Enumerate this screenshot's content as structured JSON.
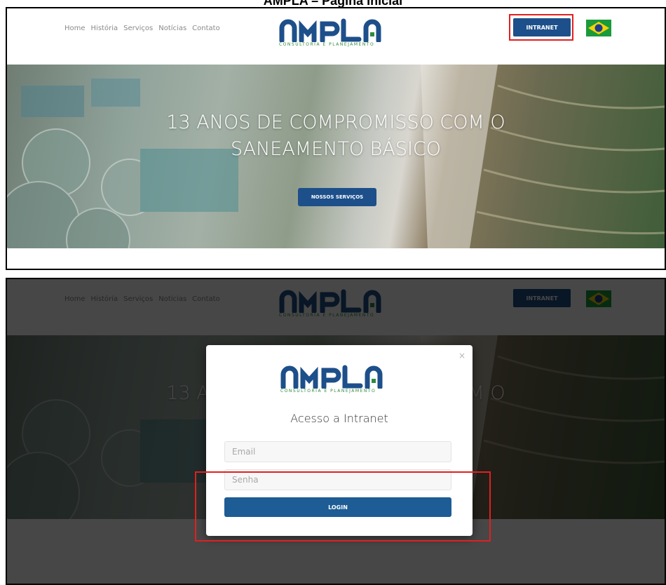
{
  "page_title": "AMPLA – Página Inicial",
  "brand": {
    "logo_text": "AMPLA",
    "tagline": "CONSULTORIA E PLANEJAMENTO",
    "color_blue": "#1d4f8a",
    "color_green": "#2e8b3e"
  },
  "nav": [
    "Home",
    "História",
    "Serviços",
    "Notícias",
    "Contato"
  ],
  "header": {
    "intranet_label": "INTRANET",
    "flag_icon": "brazil-flag-icon"
  },
  "hero": {
    "title_line1": "13 ANOS DE COMPROMISSO COM O",
    "title_line2": "SANEAMENTO BÁSICO",
    "cta_label": "NOSSOS SERVIÇOS"
  },
  "modal": {
    "title": "Acesso a Intranet",
    "close_symbol": "×",
    "email_placeholder": "Email",
    "password_placeholder": "Senha",
    "login_label": "LOGIN"
  },
  "highlight_color": "#e02020"
}
